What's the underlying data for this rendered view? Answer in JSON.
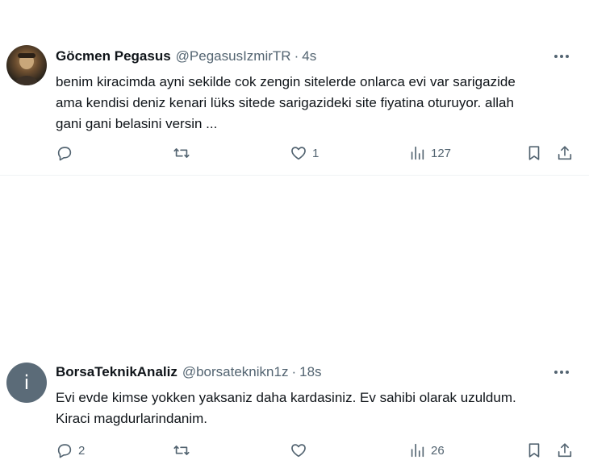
{
  "tweets": [
    {
      "display_name": "Göcmen Pegasus",
      "handle": "@PegasusIzmirTR",
      "separator": "·",
      "time": "4s",
      "text_lines": [
        "benim kiracimda ayni sekilde cok zengin sitelerde onlarca evi var sarigazide",
        "ama kendisi deniz kenari lüks sitede sarigazideki site fiyatina oturuyor. allah",
        "gani gani belasini versin ..."
      ],
      "avatar": {
        "type": "photo",
        "icon": "user-photo"
      },
      "actions": {
        "reply": {
          "icon": "reply-icon",
          "count": ""
        },
        "retweet": {
          "icon": "retweet-icon",
          "count": ""
        },
        "like": {
          "icon": "heart-icon",
          "count": "1"
        },
        "views": {
          "icon": "views-icon",
          "count": "127"
        },
        "bookmark": {
          "icon": "bookmark-icon"
        },
        "share": {
          "icon": "share-icon"
        }
      }
    },
    {
      "display_name": "BorsaTeknikAnaliz",
      "handle": "@borsateknikn1z",
      "separator": "·",
      "time": "18s",
      "text_lines": [
        "Evi evde kimse yokken yaksaniz daha kardasiniz. Ev sahibi olarak uzuldum.",
        "Kiraci magdurlarindanim."
      ],
      "avatar": {
        "type": "letter",
        "letter": "i"
      },
      "actions": {
        "reply": {
          "icon": "reply-icon",
          "count": "2"
        },
        "retweet": {
          "icon": "retweet-icon",
          "count": ""
        },
        "like": {
          "icon": "heart-icon",
          "count": ""
        },
        "views": {
          "icon": "views-icon",
          "count": "26"
        },
        "bookmark": {
          "icon": "bookmark-icon"
        },
        "share": {
          "icon": "share-icon"
        }
      }
    }
  ],
  "colors": {
    "text": "#0f1419",
    "muted": "#536471",
    "divider": "#eff3f4",
    "background": "#ffffff"
  }
}
